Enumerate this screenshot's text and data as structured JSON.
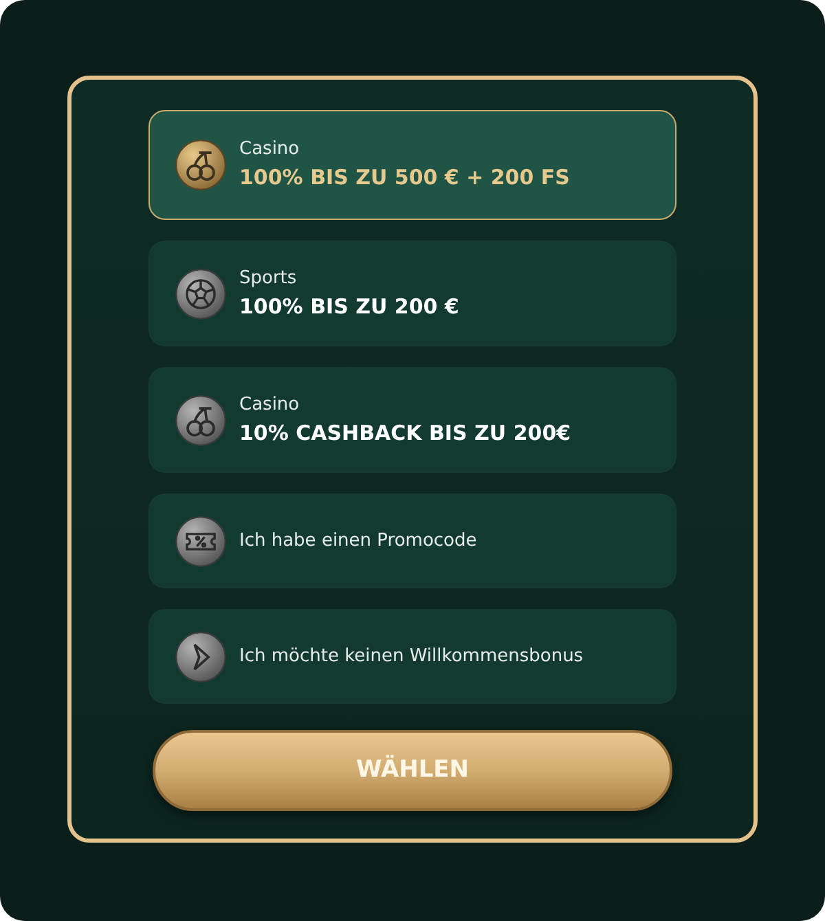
{
  "options": [
    {
      "kind": "bonus",
      "category": "Casino",
      "offer": "100% BIS ZU 500 € + 200 FS",
      "selected": true
    },
    {
      "kind": "bonus",
      "category": "Sports",
      "offer": "100% BIS ZU 200 €",
      "selected": false
    },
    {
      "kind": "bonus",
      "category": "Casino",
      "offer": "10% CASHBACK BIS ZU 200€",
      "selected": false
    },
    {
      "kind": "plain",
      "text": "Ich habe einen Promocode",
      "selected": false
    },
    {
      "kind": "plain",
      "text": "Ich möchte keinen Willkommensbonus",
      "selected": false
    }
  ],
  "button": "WÄHLEN"
}
